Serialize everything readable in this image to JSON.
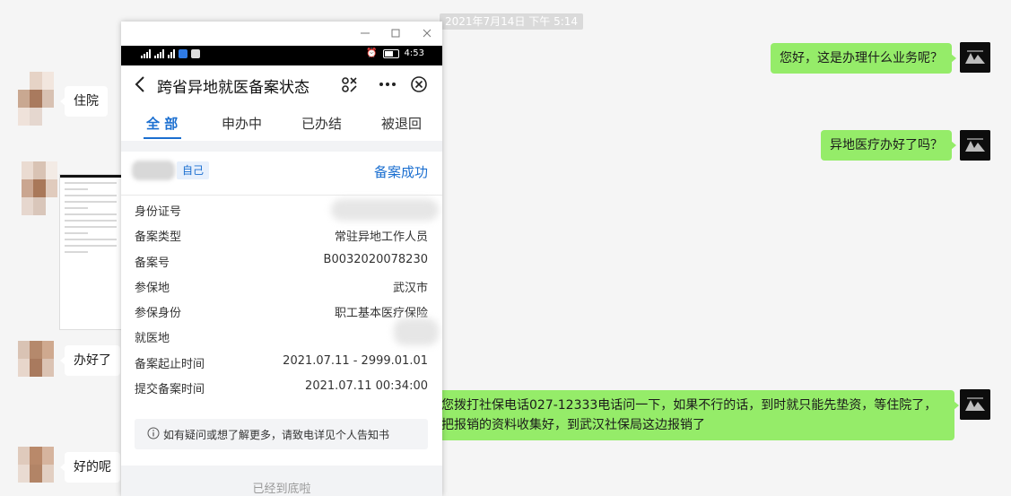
{
  "chat": {
    "timestamp": "2021年7月14日 下午 5:14",
    "messages": [
      {
        "side": "out",
        "text": "您好，这是办理什么业务呢？"
      },
      {
        "side": "in",
        "text": "住院"
      },
      {
        "side": "out",
        "text": "异地医疗办好了吗？"
      },
      {
        "side": "in",
        "text": "办好了"
      },
      {
        "side": "out",
        "text": "您拨打社保电话027-12333电话问一下，如果不行的话，到时就只能先垫资，等住院了，把报销的资料收集好，到武汉社保局这边报销了"
      },
      {
        "side": "in",
        "text": "好的呢"
      }
    ]
  },
  "phone": {
    "window_controls": [
      "minimize-icon",
      "maximize-icon",
      "close-icon"
    ],
    "statusbar": {
      "time": "4:53",
      "battery": "battery-icon",
      "alarm": "alarm-icon"
    },
    "nav": {
      "title": "跨省异地就医备案状态",
      "back_icon": "chevron-left-icon",
      "scan_icon": "scan-icon",
      "more_icon": "more-icon",
      "close_icon": "close-circle-icon"
    },
    "tabs": [
      {
        "label": "全 部",
        "active": true
      },
      {
        "label": "申办中",
        "active": false
      },
      {
        "label": "已办结",
        "active": false
      },
      {
        "label": "被退回",
        "active": false
      }
    ],
    "card": {
      "self_tag": "自己",
      "status": "备案成功",
      "fields": [
        {
          "key": "身份证号",
          "value": ""
        },
        {
          "key": "备案类型",
          "value": "常驻异地工作人员"
        },
        {
          "key": "备案号",
          "value": "B0032020078230"
        },
        {
          "key": "参保地",
          "value": "武汉市"
        },
        {
          "key": "参保身份",
          "value": "职工基本医疗保险"
        },
        {
          "key": "就医地",
          "value": ""
        },
        {
          "key": "备案起止时间",
          "value": "2021.07.11 - 2999.01.01"
        },
        {
          "key": "提交备案时间",
          "value": "2021.07.11 00:34:00"
        }
      ]
    },
    "notice": "如有疑问或想了解更多，请致电详见个人告知书",
    "footer": "已经到底啦"
  },
  "colors": {
    "accent": "#1b6fd0",
    "bubble_out": "#95ec69",
    "bubble_in": "#ffffff"
  }
}
